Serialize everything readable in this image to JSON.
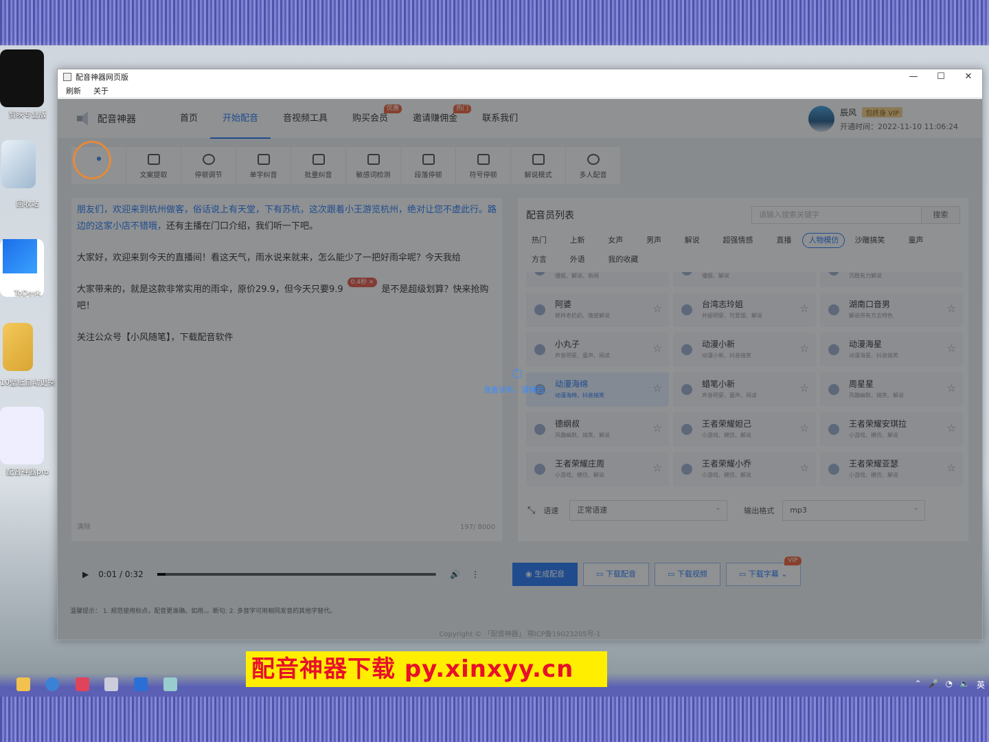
{
  "desktop": {
    "icons": [
      "剪映专业版",
      "回收站",
      "ToDesk",
      "10壁纸自动更换",
      "配音神器pro"
    ]
  },
  "window": {
    "title": "配音神器网页版",
    "menu": [
      "刷新",
      "关于"
    ],
    "controls": [
      "—",
      "☐",
      "✕"
    ]
  },
  "app": {
    "brand": "配音神器",
    "nav": [
      {
        "label": "首页",
        "badge": ""
      },
      {
        "label": "开始配音",
        "badge": ""
      },
      {
        "label": "音视频工具",
        "badge": ""
      },
      {
        "label": "购买会员",
        "badge": "优惠"
      },
      {
        "label": "邀请赚佣金",
        "badge": "热门"
      },
      {
        "label": "联系我们",
        "badge": ""
      }
    ],
    "user": {
      "name": "辰风",
      "vip": "包终身 VIP",
      "time": "开通时间：2022-11-10 11:06:24"
    },
    "tools": [
      "",
      "文案提取",
      "停顿调节",
      "单字纠音",
      "批量纠音",
      "敏感词检测",
      "段落停顿",
      "符号停顿",
      "解说模式",
      "多人配音"
    ],
    "editor": {
      "p1_hl": "朋友们，欢迎来到杭州做客，俗话说上有天堂，下有苏杭，这次跟着小王游览杭州，绝对让您不虚此行。路边的这家小店不错哦，",
      "p1_rest": "还有主播在门口介绍，我们听一下吧。",
      "p2": "大家好，欢迎来到今天的直播间！看这天气，雨水说来就来，怎么能少了一把好雨伞呢？今天我给",
      "p3a": "大家带来的，就是这款非常实用的雨伞，原价29.9，但今天只要9.9",
      "pause": "0.4秒 ×",
      "p3b": "是不是超级划算？快来抢购吧！",
      "p4": "关注公众号【小风随笔】，下载配音软件",
      "clear": "清除",
      "count": "197/ 8000"
    },
    "voices": {
      "title": "配音员列表",
      "search_placeholder": "请输入搜索关键字",
      "search_btn": "搜索",
      "categories": [
        "热门",
        "上新",
        "女声",
        "男声",
        "解说",
        "超强情感",
        "直播",
        "人物模仿",
        "沙雕搞笑",
        "童声",
        "方言",
        "外语",
        "我的收藏"
      ],
      "active_category": "人物模仿",
      "cards": [
        {
          "name": "",
          "tags": "播报、解说、新闻"
        },
        {
          "name": "",
          "tags": "播报、解说"
        },
        {
          "name": "",
          "tags": "沉稳有力解说"
        },
        {
          "name": "阿婆",
          "tags": "慈祥老奶奶、情感解说"
        },
        {
          "name": "台湾志玲姐",
          "tags": "共振明星、可爱甜、解说"
        },
        {
          "name": "湖南口音男",
          "tags": "解说带有方言特色"
        },
        {
          "name": "小丸子",
          "tags": "声音明星、童声、阅读"
        },
        {
          "name": "动漫小新",
          "tags": "动漫小新、抖音搞笑"
        },
        {
          "name": "动漫海星",
          "tags": "动漫海星、抖音搞笑"
        },
        {
          "name": "动漫海绵",
          "tags": "动漫海绵、抖音搞笑"
        },
        {
          "name": "蜡笔小新",
          "tags": "声音明星、童声、阅读"
        },
        {
          "name": "周星星",
          "tags": "风趣幽默、搞笑、解说"
        },
        {
          "name": "德纲叔",
          "tags": "风趣幽默、搞笑、解说"
        },
        {
          "name": "王者荣耀妲己",
          "tags": "小游戏、模仿、解说"
        },
        {
          "name": "王者荣耀安琪拉",
          "tags": "小游戏、模仿、解说"
        },
        {
          "name": "王者荣耀庄周",
          "tags": "小游戏、模仿、解说"
        },
        {
          "name": "王者荣耀小乔",
          "tags": "小游戏、模仿、解说"
        },
        {
          "name": "王者荣耀亚瑟",
          "tags": "小游戏、模仿、解说"
        }
      ],
      "speed_label": "语速",
      "speed_value": "正常语速",
      "format_label": "输出格式",
      "format_value": "mp3"
    },
    "player": {
      "time": "0:01 / 0:32",
      "progress": 0.03
    },
    "actions": [
      "生成配音",
      "下载配音",
      "下载视频",
      "下载字幕"
    ],
    "vip_badge": "VIP",
    "tips": "温馨提示： 1. 规范使用标点，配音更准确。如用，。断句; 2. 多音字可用相同发音的其他字替代。",
    "copyright": "Copyright © 「配音神器」 鄂ICP备19023205号-1",
    "loading": "准备试听，请稍后..."
  },
  "promo": "配音神器下载   py.xinxyy.cn",
  "tray": {
    "lang": "英"
  }
}
